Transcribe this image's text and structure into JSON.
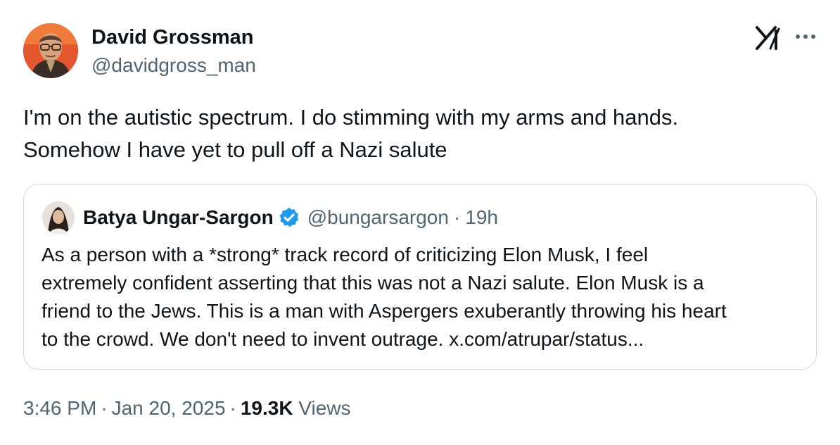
{
  "author": {
    "display_name": "David Grossman",
    "handle": "@davidgross_man",
    "avatar_icon": "profile-photo"
  },
  "header_icons": {
    "platform": "x-logo-icon",
    "menu": "more-horizontal-icon"
  },
  "tweet": {
    "lines": [
      "I'm on the autistic spectrum. I do stimming with my arms and hands.",
      "Somehow I have yet to pull off a Nazi salute"
    ]
  },
  "quoted": {
    "display_name": "Batya Ungar-Sargon",
    "verified": true,
    "verified_color": "#1d9bf0",
    "handle": "@bungarsargon",
    "separator": "·",
    "time": "19h",
    "lines": [
      "As a person with a *strong* track record of criticizing Elon Musk, I feel",
      "extremely confident asserting that this was not a Nazi salute. Elon Musk is a",
      "friend to the Jews. This is a man with Aspergers exuberantly throwing his heart",
      "to the crowd. We don't need to invent outrage. x.com/atrupar/status..."
    ]
  },
  "meta": {
    "time": "3:46 PM",
    "separator": "·",
    "date": "Jan 20, 2025",
    "views_count": "19.3K",
    "views_label": "Views"
  },
  "colors": {
    "text": "#0f1419",
    "secondary": "#536471",
    "border": "#cfd9de"
  }
}
